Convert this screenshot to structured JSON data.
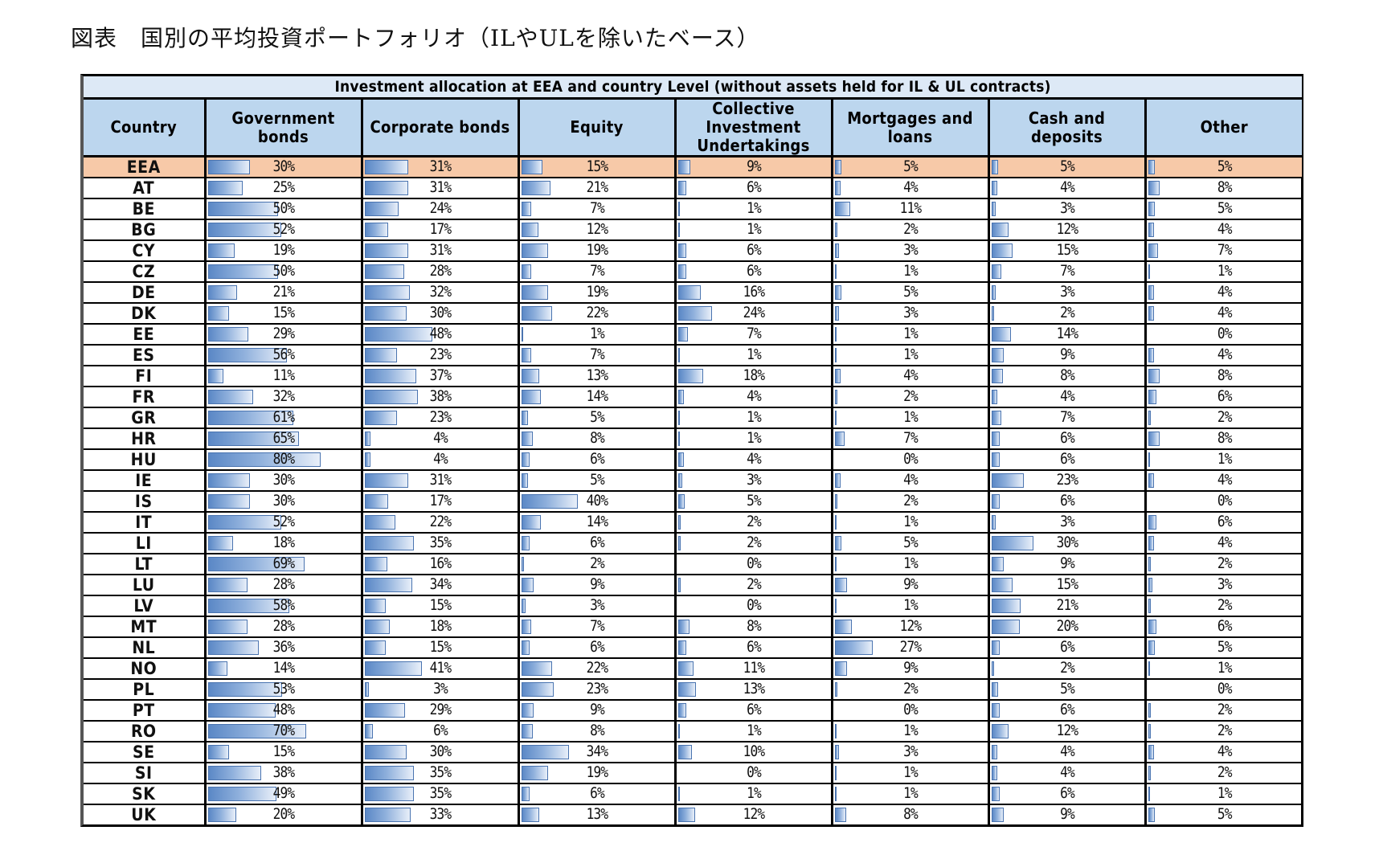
{
  "page": {
    "title": "図表　国別の平均投資ポートフォリオ（ILやULを除いたベース）"
  },
  "table": {
    "caption": "Investment allocation at EEA and country Level (without assets held for IL & UL contracts)",
    "columns": [
      "Country",
      "Government bonds",
      "Corporate bonds",
      "Equity",
      "Collective Investment Undertakings",
      "Mortgages and loans",
      "Cash and deposits",
      "Other"
    ],
    "highlight_color": "#f7c9a8",
    "header_color": "#bcd6ee",
    "bar_color": "#5b88c6",
    "rows": [
      {
        "country": "EEA",
        "values": [
          "30%",
          "31%",
          "15%",
          "9%",
          "5%",
          "5%",
          "5%"
        ],
        "highlight": true
      },
      {
        "country": "AT",
        "values": [
          "25%",
          "31%",
          "21%",
          "6%",
          "4%",
          "4%",
          "8%"
        ]
      },
      {
        "country": "BE",
        "values": [
          "50%",
          "24%",
          "7%",
          "1%",
          "11%",
          "3%",
          "5%"
        ]
      },
      {
        "country": "BG",
        "values": [
          "52%",
          "17%",
          "12%",
          "1%",
          "2%",
          "12%",
          "4%"
        ]
      },
      {
        "country": "CY",
        "values": [
          "19%",
          "31%",
          "19%",
          "6%",
          "3%",
          "15%",
          "7%"
        ]
      },
      {
        "country": "CZ",
        "values": [
          "50%",
          "28%",
          "7%",
          "6%",
          "1%",
          "7%",
          "1%"
        ]
      },
      {
        "country": "DE",
        "values": [
          "21%",
          "32%",
          "19%",
          "16%",
          "5%",
          "3%",
          "4%"
        ]
      },
      {
        "country": "DK",
        "values": [
          "15%",
          "30%",
          "22%",
          "24%",
          "3%",
          "2%",
          "4%"
        ]
      },
      {
        "country": "EE",
        "values": [
          "29%",
          "48%",
          "1%",
          "7%",
          "1%",
          "14%",
          "0%"
        ]
      },
      {
        "country": "ES",
        "values": [
          "56%",
          "23%",
          "7%",
          "1%",
          "1%",
          "9%",
          "4%"
        ]
      },
      {
        "country": "FI",
        "values": [
          "11%",
          "37%",
          "13%",
          "18%",
          "4%",
          "8%",
          "8%"
        ]
      },
      {
        "country": "FR",
        "values": [
          "32%",
          "38%",
          "14%",
          "4%",
          "2%",
          "4%",
          "6%"
        ]
      },
      {
        "country": "GR",
        "values": [
          "61%",
          "23%",
          "5%",
          "1%",
          "1%",
          "7%",
          "2%"
        ]
      },
      {
        "country": "HR",
        "values": [
          "65%",
          "4%",
          "8%",
          "1%",
          "7%",
          "6%",
          "8%"
        ]
      },
      {
        "country": "HU",
        "values": [
          "80%",
          "4%",
          "6%",
          "4%",
          "0%",
          "6%",
          "1%"
        ]
      },
      {
        "country": "IE",
        "values": [
          "30%",
          "31%",
          "5%",
          "3%",
          "4%",
          "23%",
          "4%"
        ]
      },
      {
        "country": "IS",
        "values": [
          "30%",
          "17%",
          "40%",
          "5%",
          "2%",
          "6%",
          "0%"
        ]
      },
      {
        "country": "IT",
        "values": [
          "52%",
          "22%",
          "14%",
          "2%",
          "1%",
          "3%",
          "6%"
        ]
      },
      {
        "country": "LI",
        "values": [
          "18%",
          "35%",
          "6%",
          "2%",
          "5%",
          "30%",
          "4%"
        ]
      },
      {
        "country": "LT",
        "values": [
          "69%",
          "16%",
          "2%",
          "0%",
          "1%",
          "9%",
          "2%"
        ]
      },
      {
        "country": "LU",
        "values": [
          "28%",
          "34%",
          "9%",
          "2%",
          "9%",
          "15%",
          "3%"
        ]
      },
      {
        "country": "LV",
        "values": [
          "58%",
          "15%",
          "3%",
          "0%",
          "1%",
          "21%",
          "2%"
        ]
      },
      {
        "country": "MT",
        "values": [
          "28%",
          "18%",
          "7%",
          "8%",
          "12%",
          "20%",
          "6%"
        ]
      },
      {
        "country": "NL",
        "values": [
          "36%",
          "15%",
          "6%",
          "6%",
          "27%",
          "6%",
          "5%"
        ]
      },
      {
        "country": "NO",
        "values": [
          "14%",
          "41%",
          "22%",
          "11%",
          "9%",
          "2%",
          "1%"
        ]
      },
      {
        "country": "PL",
        "values": [
          "53%",
          "3%",
          "23%",
          "13%",
          "2%",
          "5%",
          "0%"
        ]
      },
      {
        "country": "PT",
        "values": [
          "48%",
          "29%",
          "9%",
          "6%",
          "0%",
          "6%",
          "2%"
        ]
      },
      {
        "country": "RO",
        "values": [
          "70%",
          "6%",
          "8%",
          "1%",
          "1%",
          "12%",
          "2%"
        ]
      },
      {
        "country": "SE",
        "values": [
          "15%",
          "30%",
          "34%",
          "10%",
          "3%",
          "4%",
          "4%"
        ]
      },
      {
        "country": "SI",
        "values": [
          "38%",
          "35%",
          "19%",
          "0%",
          "1%",
          "4%",
          "2%"
        ]
      },
      {
        "country": "SK",
        "values": [
          "49%",
          "35%",
          "6%",
          "1%",
          "1%",
          "6%",
          "1%"
        ]
      },
      {
        "country": "UK",
        "values": [
          "20%",
          "33%",
          "13%",
          "12%",
          "8%",
          "9%",
          "5%"
        ]
      }
    ]
  }
}
